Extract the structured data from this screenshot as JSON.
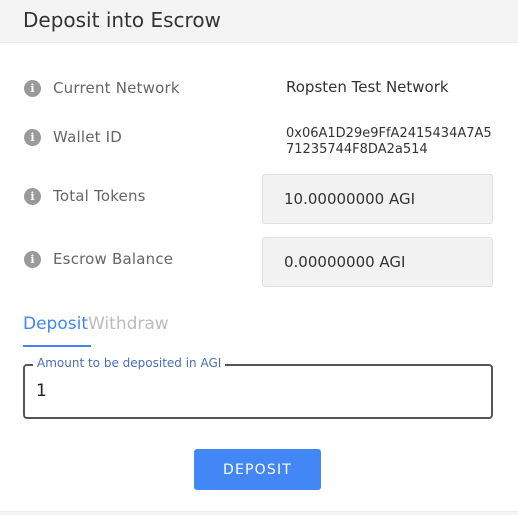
{
  "header": {
    "title": "Deposit into Escrow"
  },
  "details": {
    "network": {
      "label": "Current Network",
      "value": "Ropsten Test Network",
      "icon": "info-icon"
    },
    "wallet": {
      "label": "Wallet ID",
      "value": "0x06A1D29e9FfA2415434A7A571235744F8DA2a514",
      "icon": "info-icon"
    },
    "total_tokens": {
      "label": "Total Tokens",
      "value": "10.00000000 AGI",
      "icon": "info-icon"
    },
    "escrow_balance": {
      "label": "Escrow Balance",
      "value": "0.00000000 AGI",
      "icon": "info-icon"
    }
  },
  "tabs": [
    {
      "label": "Deposit",
      "active": true
    },
    {
      "label": "Withdraw",
      "active": false
    }
  ],
  "amount_field": {
    "legend": "Amount to be deposited in AGI",
    "value": "1"
  },
  "actions": {
    "deposit_label": "DEPOSIT"
  },
  "colors": {
    "accent": "#4287f5",
    "header_bg": "#f4f4f4",
    "value_box_bg": "#f2f2f2"
  }
}
